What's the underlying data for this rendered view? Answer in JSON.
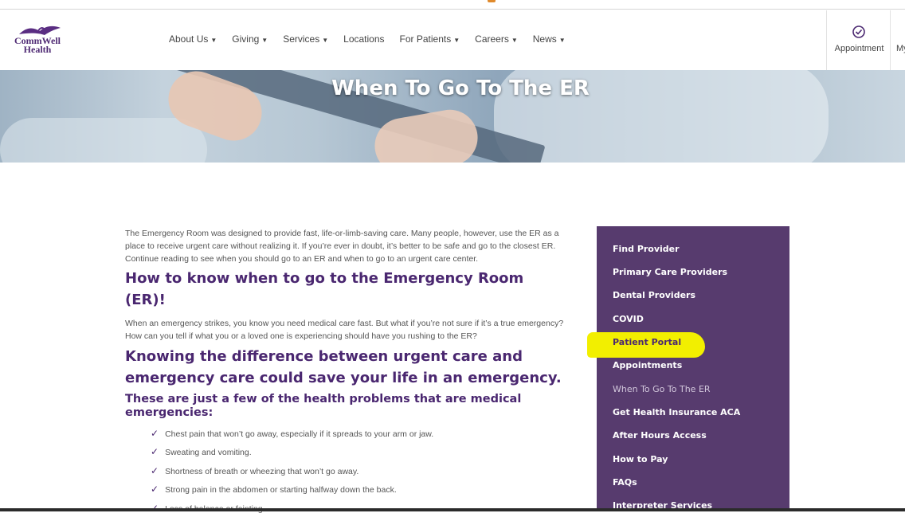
{
  "brand": {
    "name_line1": "CommWell",
    "name_line2": "Health",
    "color": "#4f2a74"
  },
  "nav": {
    "items": [
      {
        "label": "About Us",
        "dropdown": true
      },
      {
        "label": "Giving",
        "dropdown": true
      },
      {
        "label": "Services",
        "dropdown": true
      },
      {
        "label": "Locations",
        "dropdown": false
      },
      {
        "label": "For Patients",
        "dropdown": true
      },
      {
        "label": "Careers",
        "dropdown": true
      },
      {
        "label": "News",
        "dropdown": true
      }
    ],
    "appointment_label": "Appointment",
    "appointment_icon": "calendar-check-icon",
    "partial_label": "My"
  },
  "hero": {
    "title": "When To Go To The ER"
  },
  "content": {
    "intro": "The Emergency Room was designed to provide fast, life-or-limb-saving care. Many people, however, use the ER as a place to receive urgent care without realizing it. If you’re ever in doubt, it’s better to be safe and go to the closest ER. Continue reading to see when you should go to an ER and when to go to an urgent care center.",
    "heading1": "How to know when to go to the Emergency Room (ER)!",
    "para2": "When an emergency strikes, you know you need medical care fast. But what if you’re not sure if it’s a true emergency? How can you tell if what you or a loved one is experiencing should have you rushing to the ER?",
    "heading2": "Knowing the difference between urgent care and emergency care could save your life in an emergency.",
    "heading3": "These are just a few of the health problems that are medical emergencies:",
    "checklist": [
      "Chest pain that won’t go away, especially if it spreads to your arm or jaw.",
      "Sweating and vomiting.",
      "Shortness of breath or wheezing that won’t go away.",
      "Strong pain in the abdomen or starting halfway down the back.",
      "Loss of balance or fainting."
    ]
  },
  "sidebar": {
    "background": "#573b6e",
    "items": [
      {
        "label": "Find Provider"
      },
      {
        "label": "Primary Care Providers"
      },
      {
        "label": "Dental Providers"
      },
      {
        "label": "COVID"
      },
      {
        "label": "Patient Portal",
        "highlighted": true
      },
      {
        "label": "Appointments"
      },
      {
        "label": "When To Go To The ER",
        "current": true
      },
      {
        "label": "Get Health Insurance ACA"
      },
      {
        "label": "After Hours Access"
      },
      {
        "label": "How to Pay"
      },
      {
        "label": "FAQs"
      },
      {
        "label": "Interpreter Services"
      }
    ],
    "highlight_color": "#f2ef00"
  }
}
